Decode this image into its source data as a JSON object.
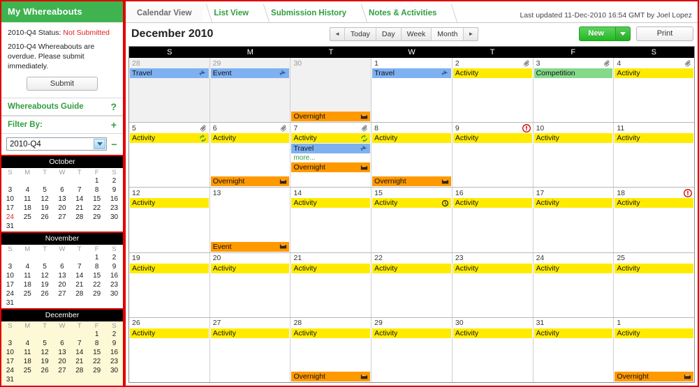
{
  "sidebar": {
    "title": "My Whereabouts",
    "status_label": "2010-Q4 Status:",
    "status_value": "Not Submitted",
    "message": "2010-Q4 Whereabouts are overdue. Please submit immediately.",
    "submit_label": "Submit",
    "guide_label": "Whereabouts Guide",
    "guide_mark": "?",
    "filter_label": "Filter By:",
    "filter_add_mark": "+",
    "filter_remove_mark": "−",
    "filter_value": "2010-Q4",
    "filter_options": [
      "2010-Q4"
    ],
    "mini_calendars": [
      {
        "name": "October",
        "selected": false,
        "dow": [
          "S",
          "M",
          "T",
          "W",
          "T",
          "F",
          "S"
        ],
        "weeks": [
          [
            "",
            "",
            "",
            "",
            "",
            "1",
            "2"
          ],
          [
            "3",
            "4",
            "5",
            "6",
            "7",
            "8",
            "9"
          ],
          [
            "10",
            "11",
            "12",
            "13",
            "14",
            "15",
            "16"
          ],
          [
            "17",
            "18",
            "19",
            "20",
            "21",
            "22",
            "23"
          ],
          [
            "24",
            "25",
            "26",
            "27",
            "28",
            "29",
            "30"
          ],
          [
            "31",
            "",
            "",
            "",
            "",
            "",
            ""
          ]
        ],
        "highlight_day": "24"
      },
      {
        "name": "November",
        "selected": false,
        "dow": [
          "S",
          "M",
          "T",
          "W",
          "T",
          "F",
          "S"
        ],
        "weeks": [
          [
            "",
            "",
            "",
            "",
            "",
            "1",
            "2"
          ],
          [
            "3",
            "4",
            "5",
            "6",
            "7",
            "8",
            "9"
          ],
          [
            "10",
            "11",
            "12",
            "13",
            "14",
            "15",
            "16"
          ],
          [
            "17",
            "18",
            "19",
            "20",
            "21",
            "22",
            "23"
          ],
          [
            "24",
            "25",
            "26",
            "27",
            "28",
            "29",
            "30"
          ],
          [
            "31",
            "",
            "",
            "",
            "",
            "",
            ""
          ]
        ],
        "highlight_day": ""
      },
      {
        "name": "December",
        "selected": true,
        "dow": [
          "S",
          "M",
          "T",
          "W",
          "T",
          "F",
          "S"
        ],
        "weeks": [
          [
            "",
            "",
            "",
            "",
            "",
            "1",
            "2"
          ],
          [
            "3",
            "4",
            "5",
            "6",
            "7",
            "8",
            "9"
          ],
          [
            "10",
            "11",
            "12",
            "13",
            "14",
            "15",
            "16"
          ],
          [
            "17",
            "18",
            "19",
            "20",
            "21",
            "22",
            "23"
          ],
          [
            "24",
            "25",
            "26",
            "27",
            "28",
            "29",
            "30"
          ],
          [
            "31",
            "",
            "",
            "",
            "",
            "",
            ""
          ]
        ],
        "highlight_day": ""
      }
    ]
  },
  "tabs": [
    {
      "label": "Calendar View",
      "active": true
    },
    {
      "label": "List View",
      "active": false
    },
    {
      "label": "Submission History",
      "active": false
    },
    {
      "label": "Notes & Activities",
      "active": false
    }
  ],
  "last_updated": "Last updated 11-Dec-2010 16:54 GMT by Joel Lopez",
  "toolbar": {
    "month_title": "December 2010",
    "prev_label": "◄",
    "next_label": "►",
    "views": [
      {
        "label": "Today",
        "active": false
      },
      {
        "label": "Day",
        "active": false
      },
      {
        "label": "Week",
        "active": false
      },
      {
        "label": "Month",
        "active": true
      }
    ],
    "new_label": "New",
    "print_label": "Print"
  },
  "calendar": {
    "dow": [
      "S",
      "M",
      "T",
      "W",
      "T",
      "F",
      "S"
    ],
    "weeks": [
      [
        {
          "day": "28",
          "out": true,
          "attach": false,
          "alert": false,
          "chips": [
            {
              "label": "Travel",
              "type": "travel",
              "icon": "plane-icon"
            }
          ]
        },
        {
          "day": "29",
          "out": true,
          "attach": false,
          "alert": false,
          "chips": [
            {
              "label": "Event",
              "type": "travel",
              "icon": "plane-icon"
            }
          ]
        },
        {
          "day": "30",
          "out": true,
          "attach": false,
          "alert": false,
          "chips": [
            {
              "label": "Overnight",
              "type": "overnight",
              "icon": "bed-icon"
            }
          ]
        },
        {
          "day": "1",
          "out": false,
          "attach": false,
          "alert": false,
          "chips": [
            {
              "label": "Travel",
              "type": "travel",
              "icon": "plane-icon"
            }
          ]
        },
        {
          "day": "2",
          "out": false,
          "attach": true,
          "alert": false,
          "chips": [
            {
              "label": "Activity",
              "type": "activity",
              "icon": ""
            }
          ]
        },
        {
          "day": "3",
          "out": false,
          "attach": true,
          "alert": false,
          "chips": [
            {
              "label": "Competition",
              "type": "competition",
              "icon": ""
            }
          ]
        },
        {
          "day": "4",
          "out": false,
          "attach": true,
          "alert": false,
          "chips": [
            {
              "label": "Activity",
              "type": "activity",
              "icon": ""
            }
          ]
        }
      ],
      [
        {
          "day": "5",
          "out": false,
          "attach": true,
          "alert": false,
          "chips": [
            {
              "label": "Activity",
              "type": "activity",
              "icon": "recurrence-icon"
            }
          ]
        },
        {
          "day": "6",
          "out": false,
          "attach": true,
          "alert": false,
          "chips": [
            {
              "label": "Activity",
              "type": "activity",
              "icon": ""
            },
            {
              "label": "Overnight",
              "type": "overnight",
              "icon": "bed-icon"
            }
          ]
        },
        {
          "day": "7",
          "out": false,
          "attach": true,
          "alert": false,
          "more": "more...",
          "chips": [
            {
              "label": "Activity",
              "type": "activity",
              "icon": "recurrence-icon"
            },
            {
              "label": "Travel",
              "type": "travel",
              "icon": "plane-icon"
            },
            {
              "label": "Overnight",
              "type": "overnight",
              "icon": "bed-icon"
            }
          ]
        },
        {
          "day": "8",
          "out": false,
          "attach": false,
          "alert": false,
          "chips": [
            {
              "label": "Activity",
              "type": "activity",
              "icon": ""
            },
            {
              "label": "Overnight",
              "type": "overnight",
              "icon": "bed-icon"
            }
          ]
        },
        {
          "day": "9",
          "out": false,
          "attach": false,
          "alert": true,
          "chips": [
            {
              "label": "Activity",
              "type": "activity",
              "icon": ""
            }
          ]
        },
        {
          "day": "10",
          "out": false,
          "attach": false,
          "alert": false,
          "chips": [
            {
              "label": "Activity",
              "type": "activity",
              "icon": ""
            }
          ]
        },
        {
          "day": "11",
          "out": false,
          "attach": false,
          "alert": false,
          "chips": [
            {
              "label": "Activity",
              "type": "activity",
              "icon": ""
            }
          ]
        }
      ],
      [
        {
          "day": "12",
          "out": false,
          "attach": false,
          "alert": false,
          "chips": [
            {
              "label": "Activity",
              "type": "activity",
              "icon": ""
            }
          ]
        },
        {
          "day": "13",
          "out": false,
          "attach": false,
          "alert": false,
          "chips": [
            {
              "label": "Event",
              "type": "overnight",
              "icon": "bed-icon"
            }
          ]
        },
        {
          "day": "14",
          "out": false,
          "attach": false,
          "alert": false,
          "chips": [
            {
              "label": "Activity",
              "type": "activity",
              "icon": ""
            }
          ]
        },
        {
          "day": "15",
          "out": false,
          "attach": false,
          "alert": false,
          "chips": [
            {
              "label": "Activity",
              "type": "activity",
              "icon": "clock-icon"
            }
          ]
        },
        {
          "day": "16",
          "out": false,
          "attach": false,
          "alert": false,
          "chips": [
            {
              "label": "Activity",
              "type": "activity",
              "icon": ""
            }
          ]
        },
        {
          "day": "17",
          "out": false,
          "attach": false,
          "alert": false,
          "chips": [
            {
              "label": "Activity",
              "type": "activity",
              "icon": ""
            }
          ]
        },
        {
          "day": "18",
          "out": false,
          "attach": false,
          "alert": true,
          "chips": [
            {
              "label": "Activity",
              "type": "activity",
              "icon": ""
            }
          ]
        }
      ],
      [
        {
          "day": "19",
          "out": false,
          "attach": false,
          "alert": false,
          "chips": [
            {
              "label": "Activity",
              "type": "activity",
              "icon": ""
            }
          ]
        },
        {
          "day": "20",
          "out": false,
          "attach": false,
          "alert": false,
          "chips": [
            {
              "label": "Activity",
              "type": "activity",
              "icon": ""
            }
          ]
        },
        {
          "day": "21",
          "out": false,
          "attach": false,
          "alert": false,
          "chips": [
            {
              "label": "Activity",
              "type": "activity",
              "icon": ""
            }
          ]
        },
        {
          "day": "22",
          "out": false,
          "attach": false,
          "alert": false,
          "chips": [
            {
              "label": "Activity",
              "type": "activity",
              "icon": ""
            }
          ]
        },
        {
          "day": "23",
          "out": false,
          "attach": false,
          "alert": false,
          "chips": [
            {
              "label": "Activity",
              "type": "activity",
              "icon": ""
            }
          ]
        },
        {
          "day": "24",
          "out": false,
          "attach": false,
          "alert": false,
          "chips": [
            {
              "label": "Activity",
              "type": "activity",
              "icon": ""
            }
          ]
        },
        {
          "day": "25",
          "out": false,
          "attach": false,
          "alert": false,
          "chips": [
            {
              "label": "Activity",
              "type": "activity",
              "icon": ""
            }
          ]
        }
      ],
      [
        {
          "day": "26",
          "out": false,
          "attach": false,
          "alert": false,
          "chips": [
            {
              "label": "Activity",
              "type": "activity",
              "icon": ""
            }
          ]
        },
        {
          "day": "27",
          "out": false,
          "attach": false,
          "alert": false,
          "chips": [
            {
              "label": "Activity",
              "type": "activity",
              "icon": ""
            }
          ]
        },
        {
          "day": "28",
          "out": false,
          "attach": false,
          "alert": false,
          "chips": [
            {
              "label": "Activity",
              "type": "activity",
              "icon": ""
            },
            {
              "label": "Overnight",
              "type": "overnight",
              "icon": "bed-icon"
            }
          ]
        },
        {
          "day": "29",
          "out": false,
          "attach": false,
          "alert": false,
          "chips": [
            {
              "label": "Activity",
              "type": "activity",
              "icon": ""
            }
          ]
        },
        {
          "day": "30",
          "out": false,
          "attach": false,
          "alert": false,
          "chips": [
            {
              "label": "Activity",
              "type": "activity",
              "icon": ""
            }
          ]
        },
        {
          "day": "31",
          "out": false,
          "attach": false,
          "alert": false,
          "chips": [
            {
              "label": "Activity",
              "type": "activity",
              "icon": ""
            }
          ]
        },
        {
          "day": "1",
          "out": false,
          "attach": false,
          "alert": false,
          "chips": [
            {
              "label": "Activity",
              "type": "activity",
              "icon": ""
            },
            {
              "label": "Overnight",
              "type": "overnight",
              "icon": "bed-icon"
            }
          ]
        }
      ]
    ]
  },
  "colors": {
    "brand_green": "#3fb34f",
    "link_green": "#2f9e3f",
    "border_red": "#e00000",
    "travel": "#7eb1f2",
    "activity": "#ffeb00",
    "competition": "#84d98a",
    "overnight": "#ff9900",
    "alert_red": "#d00000",
    "selected_month_bg": "#fdf8d6"
  }
}
